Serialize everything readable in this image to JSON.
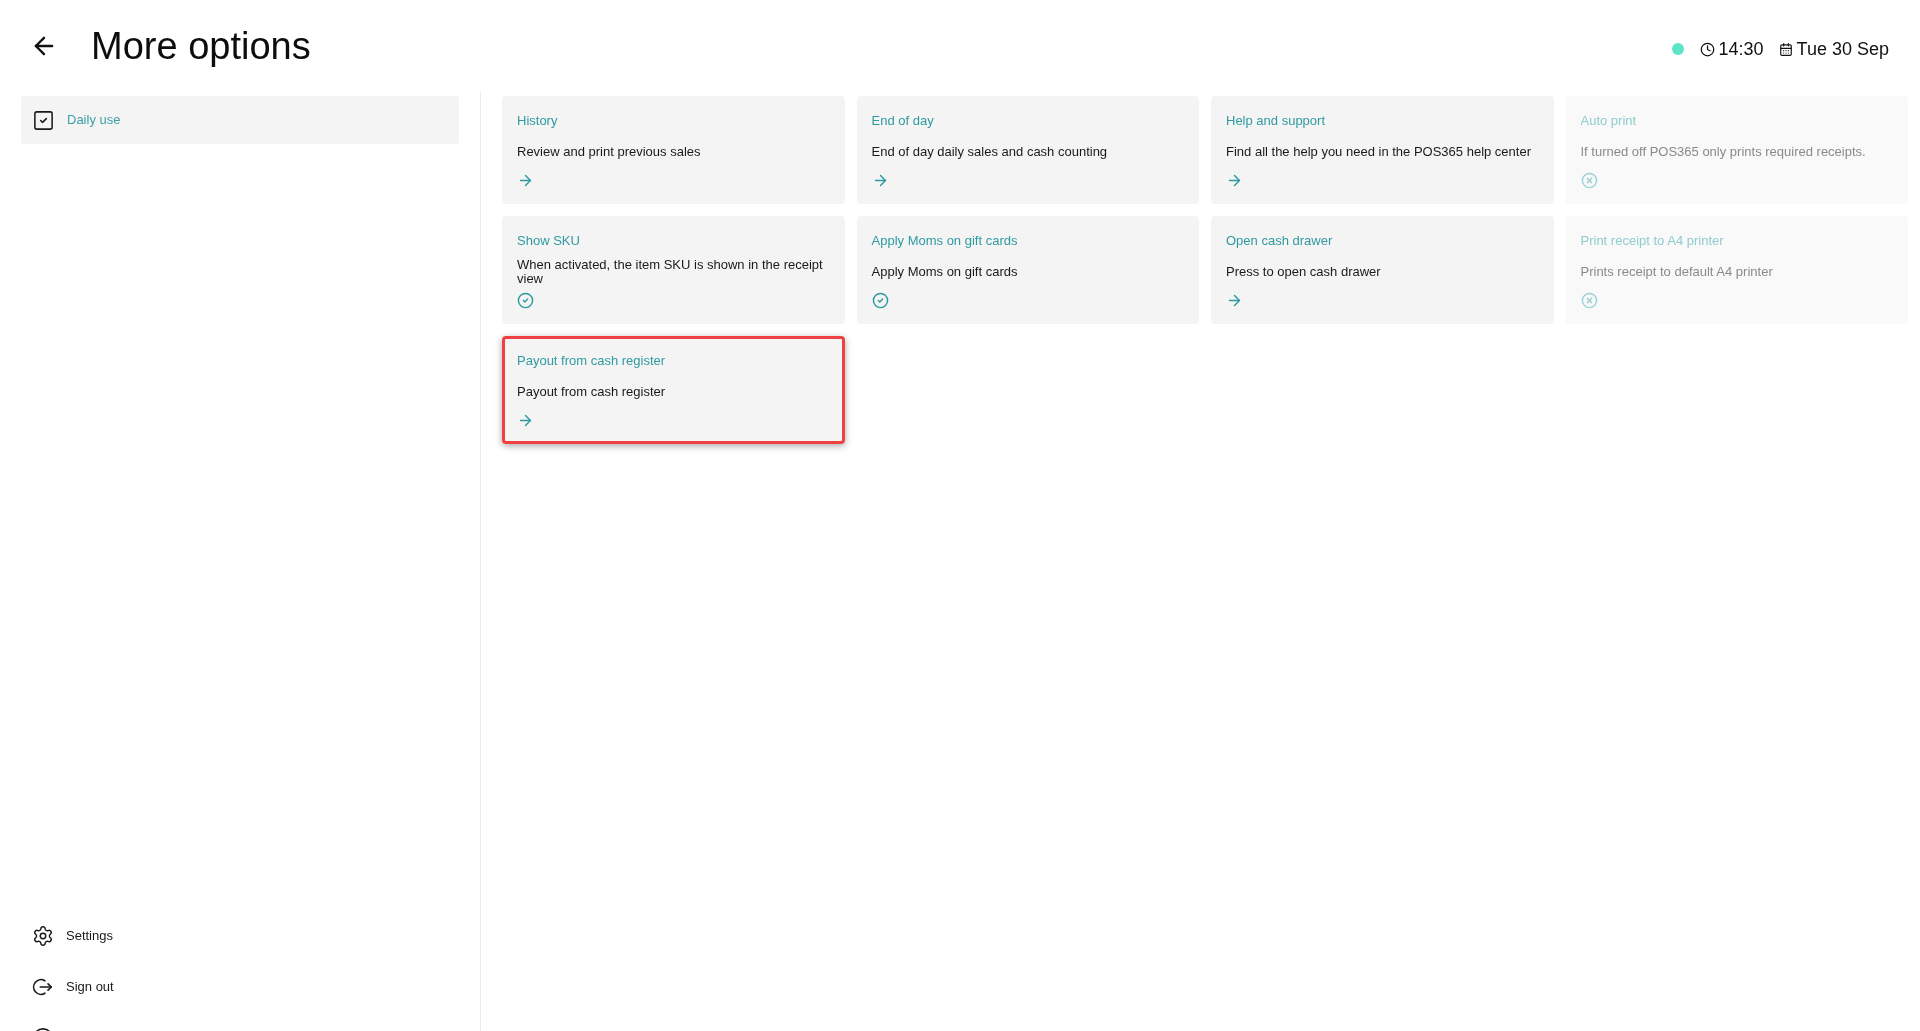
{
  "header": {
    "title": "More options",
    "connected": true,
    "time": "14:30",
    "date": "Tue 30 Sep"
  },
  "sidebar": {
    "items": [
      {
        "label": "Daily use",
        "selected": true
      }
    ],
    "footer": [
      {
        "kind": "settings",
        "label": "Settings"
      },
      {
        "kind": "sign_out",
        "label": "Sign out"
      },
      {
        "kind": "circle"
      }
    ]
  },
  "cards": [
    {
      "title": "History",
      "description": "Review and print previous sales",
      "kind": "link",
      "highlighted": false
    },
    {
      "title": "End of day",
      "description": "End of day daily sales and cash counting",
      "kind": "link",
      "highlighted": false
    },
    {
      "title": "Help and support",
      "description": "Find all the help you need in the POS365 help center",
      "kind": "link",
      "highlighted": false
    },
    {
      "title": "Auto print",
      "description": "If turned off POS365 only prints required receipts.",
      "kind": "toggle",
      "on": false,
      "highlighted": false
    },
    {
      "title": "Show SKU",
      "description": "When activated, the item SKU is shown in the receipt view",
      "kind": "toggle",
      "on": true,
      "highlighted": false
    },
    {
      "title": "Apply Moms on gift cards",
      "description": "Apply Moms on gift cards",
      "kind": "toggle",
      "on": true,
      "highlighted": false
    },
    {
      "title": "Open cash drawer",
      "description": "Press to open cash drawer",
      "kind": "link",
      "highlighted": false
    },
    {
      "title": "Print receipt to A4 printer",
      "description": "Prints receipt to default A4 printer",
      "kind": "toggle",
      "on": false,
      "highlighted": false
    },
    {
      "title": "Payout from cash register",
      "description": "Payout from cash register",
      "kind": "link",
      "highlighted": true
    }
  ]
}
